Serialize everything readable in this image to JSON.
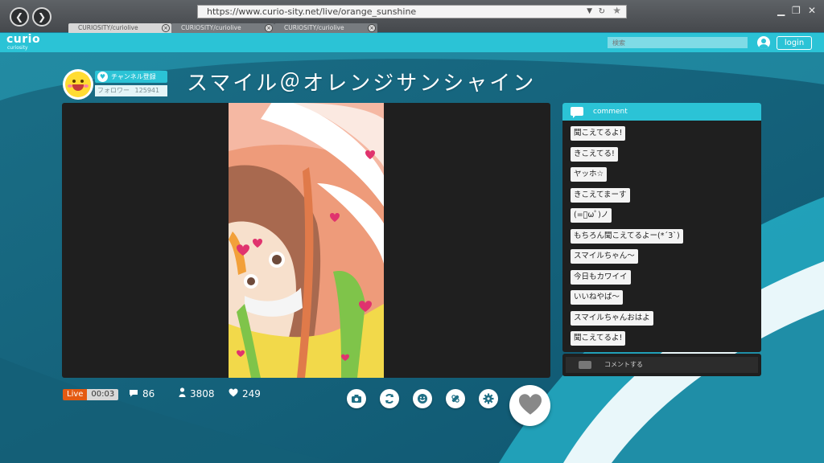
{
  "browser": {
    "url": "https://www.curio-sity.net/live/orange_sunshine",
    "tabs": [
      {
        "label": "CURIOSITY/curiolive",
        "active": true
      },
      {
        "label": "CURIOSITY/curiolive",
        "active": false
      },
      {
        "label": "CURIOSITY/curiolive",
        "active": false
      }
    ]
  },
  "site": {
    "logo": "curio",
    "logo_sub": "curiosity",
    "search_placeholder": "検索",
    "login_label": "login"
  },
  "channel": {
    "subscribe_label": "チャンネル登録",
    "followers_label": "フォロワー",
    "followers_count": "125941",
    "title": "スマイル＠オレンジサンシャイン"
  },
  "comments": {
    "header": "comment",
    "items": [
      "聞こえてるよ!",
      "きこえてる!",
      "ヤッホ☆",
      "きこえてまーす",
      "(=ﾟωﾟ)ノ",
      "もちろん聞こえてるよー(*´3`)",
      "スマイルちゃん〜",
      "今日もカワイイ",
      "いいねやば〜",
      "スマイルちゃんおはよ",
      "聞こえてるよ!"
    ],
    "input_placeholder": "コメントする"
  },
  "stats": {
    "live_label": "Live",
    "elapsed": "00:03",
    "comment_count": "86",
    "viewer_count": "3808",
    "like_count": "249"
  },
  "colors": {
    "accent": "#2bc3d6",
    "live": "#e45a12",
    "panel": "#1f1f1f",
    "background": "#1e7b94"
  },
  "icons": {
    "actions": [
      "camera-icon",
      "rotate-icon",
      "smile-icon",
      "bandage-icon",
      "settings-icon"
    ],
    "like": "heart-icon"
  }
}
